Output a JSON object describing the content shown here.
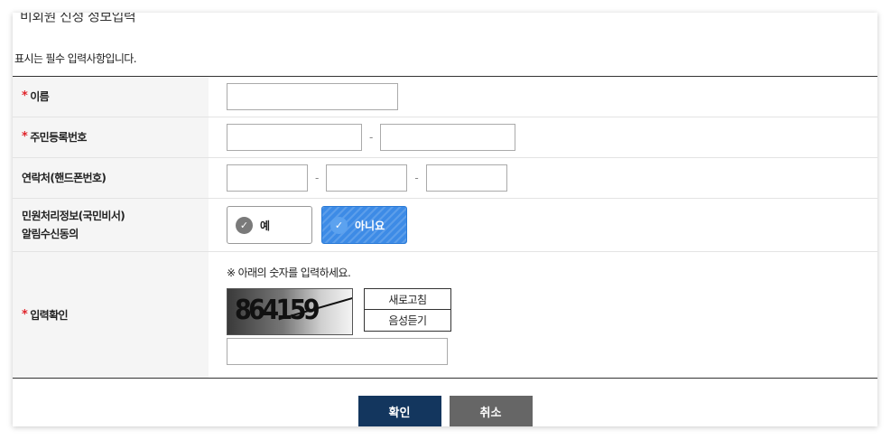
{
  "page": {
    "title": "비회원 신청 정보입력",
    "required_notice": "표시는 필수 입력사항입니다."
  },
  "form": {
    "required_mark": "*",
    "name": {
      "label": "이름"
    },
    "resident_number": {
      "label": "주민등록번호",
      "separator": "-"
    },
    "phone": {
      "label": "연락처(핸드폰번호)",
      "separator": "-"
    },
    "consent": {
      "label_line1": "민원처리정보(국민비서)",
      "label_line2": "알림수신동의",
      "option_yes": "예",
      "option_no": "아니요",
      "selected": "아니요"
    },
    "captcha": {
      "label": "입력확인",
      "note": "※ 아래의 숫자를 입력하세요.",
      "digits": "864159",
      "refresh_label": "새로고침",
      "audio_label": "음성듣기"
    }
  },
  "actions": {
    "confirm_label": "확인",
    "cancel_label": "취소"
  },
  "colors": {
    "required": "#e0242b",
    "selected_option": "#3d8be6",
    "confirm_button": "#13365e",
    "cancel_button": "#666666"
  }
}
